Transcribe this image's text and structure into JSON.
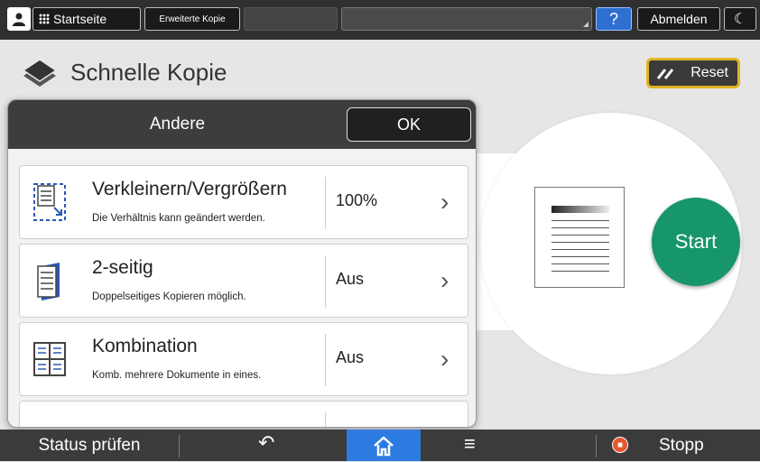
{
  "topbar": {
    "home_label": "Startseite",
    "copy_tab_label": "Erweiterte Kopie",
    "help_label": "?",
    "logout_label": "Abmelden",
    "moon_label": "☾"
  },
  "page": {
    "title": "Schnelle Kopie",
    "reset_label": "Reset"
  },
  "dialog": {
    "title": "Andere",
    "ok_label": "OK",
    "rows": [
      {
        "title": "Verkleinern/Vergrößern",
        "desc": "Die Verhältnis kann geändert werden.",
        "value": "100%",
        "icon": "resize-icon"
      },
      {
        "title": "2-seitig",
        "desc": "Doppelseitiges Kopieren möglich.",
        "value": "Aus",
        "icon": "duplex-icon"
      },
      {
        "title": "Kombination",
        "desc": "Komb. mehrere Dokumente in eines.",
        "value": "Aus",
        "icon": "combine-icon"
      }
    ]
  },
  "preview": {
    "start_label": "Start"
  },
  "bottombar": {
    "status_label": "Status prüfen",
    "back_glyph": "↶",
    "menu_glyph": "≡",
    "stop_label": "Stopp"
  },
  "colors": {
    "start": "#17956b",
    "home_active": "#2d7be1",
    "reset_border": "#e2b320",
    "help": "#2e6fd1"
  }
}
